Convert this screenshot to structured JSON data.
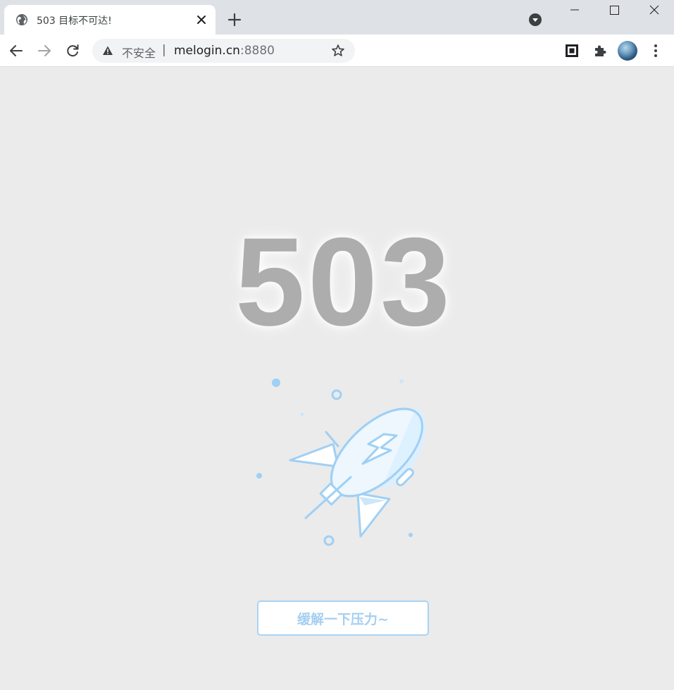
{
  "browser": {
    "tab": {
      "title": "503 目标不可达!",
      "favicon": "globe-icon"
    },
    "new_tab_icon": "plus-icon",
    "window_controls": [
      "minimize-icon",
      "maximize-icon",
      "close-icon"
    ],
    "omnibox": {
      "security_label": "不安全",
      "separator": "|",
      "url_host": "melogin.cn",
      "url_port": ":8880"
    }
  },
  "page": {
    "error_code": "503",
    "illustration": "rocket-icon",
    "relieve_button_label": "缓解一下压力~"
  },
  "colors": {
    "page_background": "#ebebeb",
    "code_text": "#adadad",
    "accent_blue": "#a6cff0"
  }
}
